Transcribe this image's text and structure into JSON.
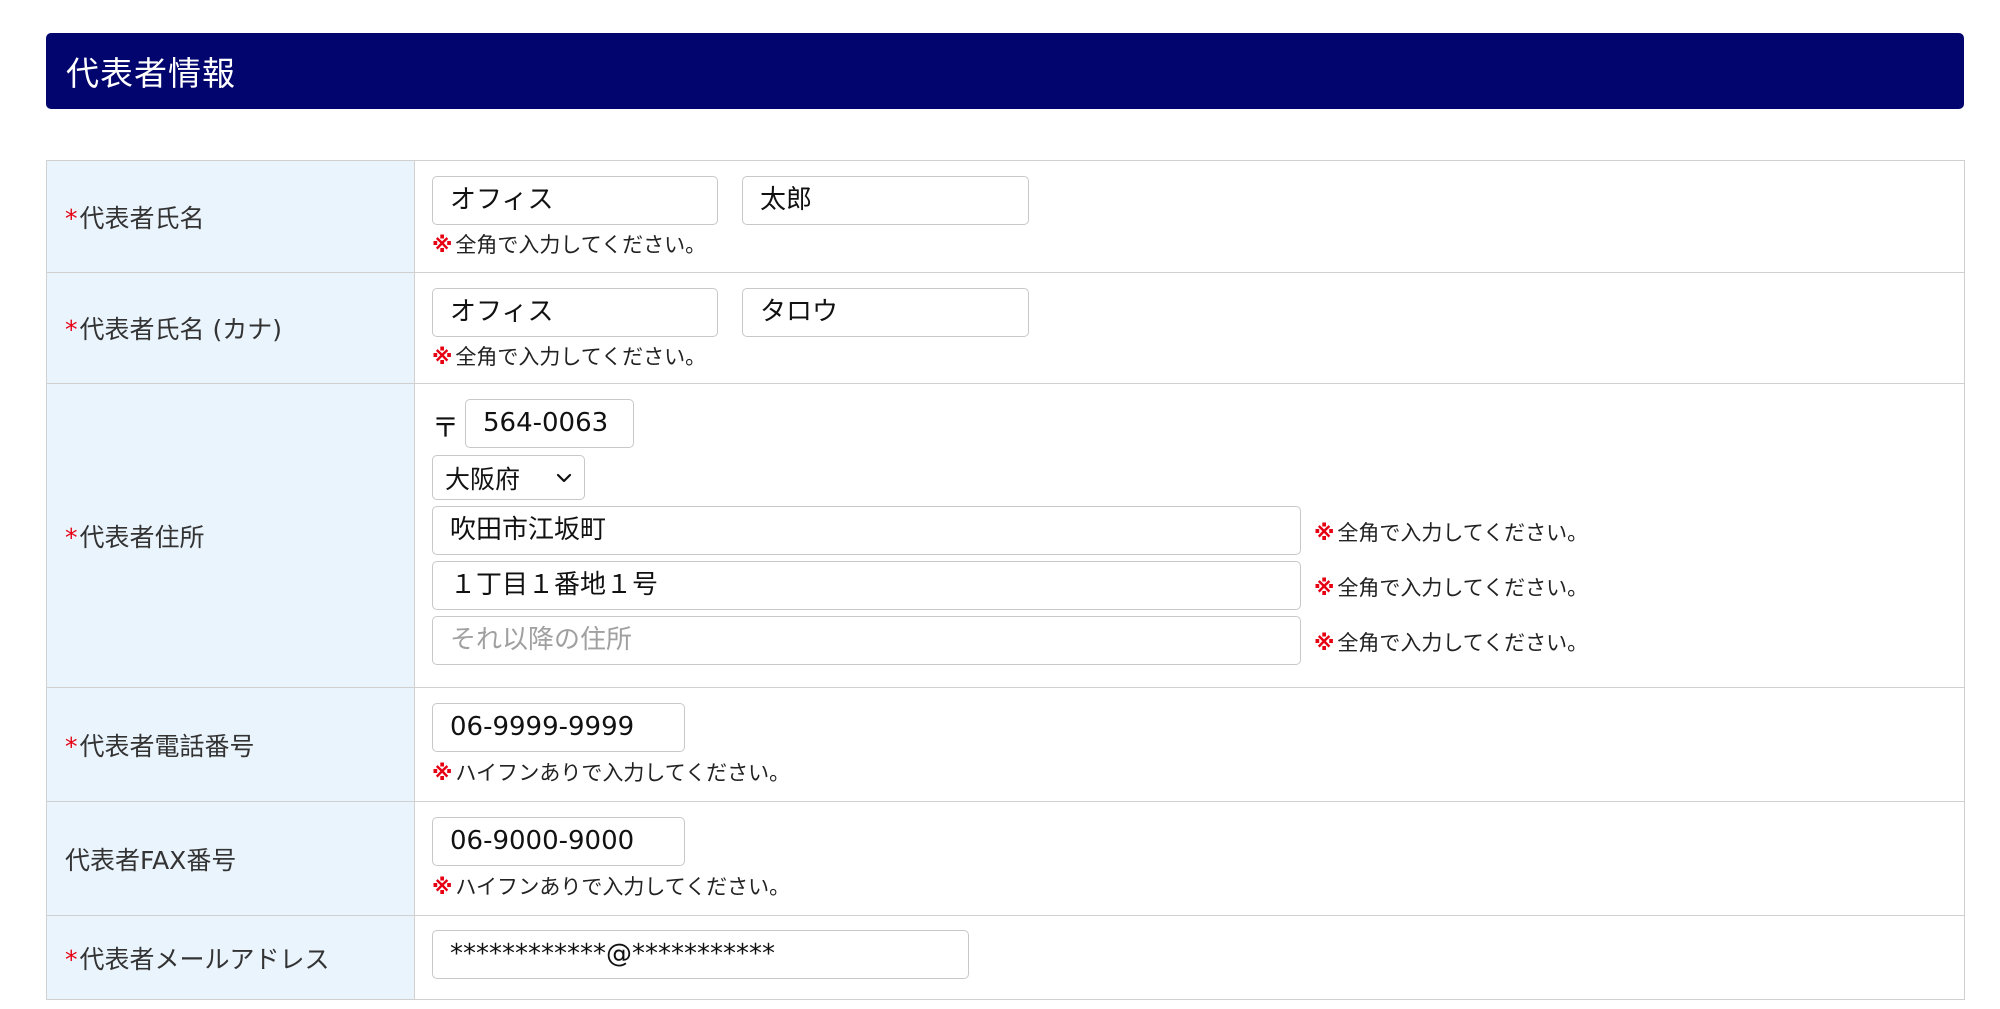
{
  "section_title": "代表者情報",
  "required_mark": "*",
  "note_mark": "※",
  "fields": {
    "name": {
      "label": "代表者氏名",
      "last_value": "オフィス",
      "first_value": "太郎",
      "note": "全角で入力してください。"
    },
    "kana": {
      "label": "代表者氏名 (カナ)",
      "last_value": "オフィス",
      "first_value": "タロウ",
      "note": "全角で入力してください。"
    },
    "address": {
      "label": "代表者住所",
      "postal_mark": "〒",
      "postal_value": "564-0063",
      "prefecture": "大阪府",
      "city_value": "吹田市江坂町",
      "street_value": "１丁目１番地１号",
      "building_placeholder": "それ以降の住所",
      "city_note": "全角で入力してください。",
      "street_note": "全角で入力してください。",
      "building_note": "全角で入力してください。"
    },
    "phone": {
      "label": "代表者電話番号",
      "value": "06-9999-9999",
      "note": "ハイフンありで入力してください。"
    },
    "fax": {
      "label": "代表者FAX番号",
      "value": "06-9000-9000",
      "note": "ハイフンありで入力してください。"
    },
    "email": {
      "label": "代表者メールアドレス",
      "value": "************@***********"
    }
  },
  "colors": {
    "header_bg": "#02056d",
    "label_bg": "#eaf4fd",
    "required": "#e60012"
  },
  "icons": {
    "select_arrow": "chevron-down-icon"
  }
}
